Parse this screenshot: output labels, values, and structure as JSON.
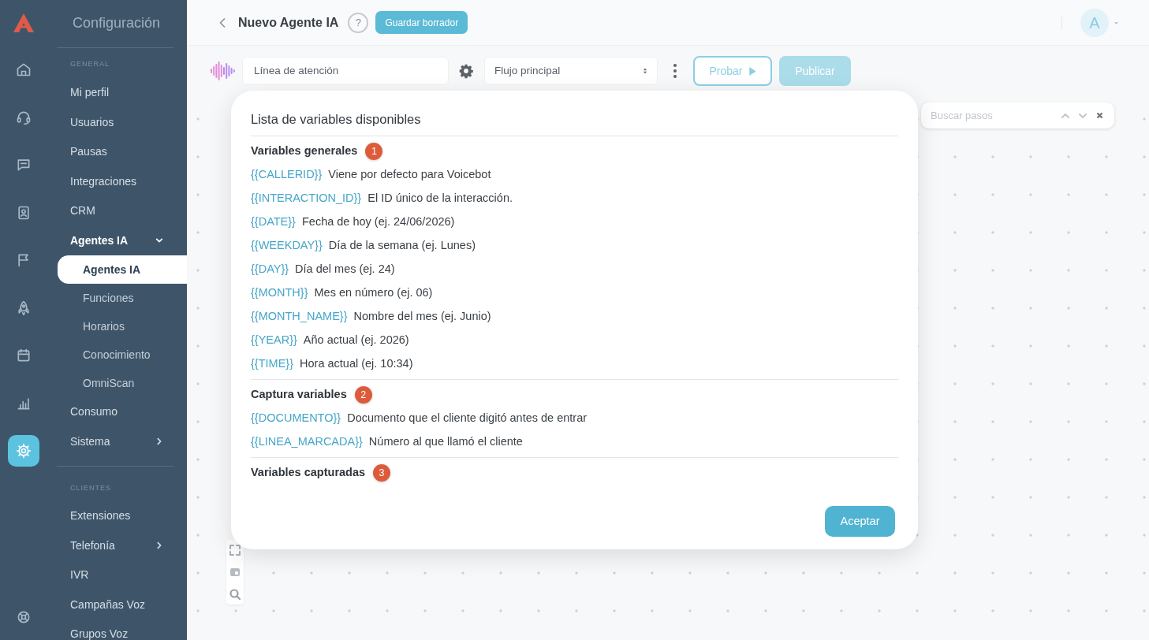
{
  "sidebar": {
    "rail": [
      {
        "kind": "home",
        "selected": false
      },
      {
        "kind": "headset",
        "selected": false
      },
      {
        "kind": "chat",
        "selected": false
      },
      {
        "kind": "contacts",
        "selected": false
      },
      {
        "kind": "flag",
        "selected": false
      },
      {
        "kind": "rocket",
        "selected": false
      },
      {
        "kind": "calendar",
        "selected": false
      },
      {
        "kind": "chart",
        "selected": false
      },
      {
        "kind": "settings",
        "selected": true
      }
    ],
    "rail_bottom": [
      {
        "kind": "support",
        "selected": false
      }
    ],
    "panel": {
      "title": "Configuración",
      "sections": [
        {
          "label": "GENERAL",
          "items": [
            {
              "label": "Mi perfil",
              "selected": false
            },
            {
              "label": "Usuarios",
              "selected": false
            },
            {
              "label": "Pausas",
              "selected": false
            },
            {
              "label": "Integraciones",
              "selected": false
            },
            {
              "label": "CRM",
              "selected": false
            },
            {
              "label": "Agentes IA",
              "selected": false,
              "expanded": true,
              "children": [
                {
                  "label": "Agentes IA",
                  "selected": true
                },
                {
                  "label": "Funciones",
                  "selected": false
                },
                {
                  "label": "Horarios",
                  "selected": false
                },
                {
                  "label": "Conocimiento",
                  "selected": false
                },
                {
                  "label": "OmniScan",
                  "selected": false
                }
              ]
            },
            {
              "label": "Consumo",
              "selected": false
            },
            {
              "label": "Sistema",
              "selected": false,
              "expanded": false
            }
          ]
        },
        {
          "label": "CLIENTES",
          "items": [
            {
              "label": "Extensiones",
              "selected": false
            },
            {
              "label": "Telefonía",
              "selected": false,
              "expanded": false
            },
            {
              "label": "IVR",
              "selected": false
            },
            {
              "label": "Campañas Voz",
              "selected": false
            },
            {
              "label": "Grupos Voz",
              "selected": false
            }
          ]
        }
      ]
    }
  },
  "header": {
    "title": "Nuevo Agente IA",
    "help": "?",
    "save_button": "Guardar borrador",
    "avatar": "A"
  },
  "toolbar": {
    "name_field": {
      "value": "Línea de atención"
    },
    "flow_select": {
      "value": "Flujo principal"
    },
    "test_button": "Probar",
    "publish_button": {
      "label": "Publicar",
      "disabled": true
    }
  },
  "canvas": {
    "search": {
      "placeholder": "Buscar pasos"
    }
  },
  "modal": {
    "title": "Lista de variables disponibles",
    "sections": [
      {
        "title": "Variables generales",
        "badge": "1",
        "variables": [
          {
            "name": "{{CALLERID}}",
            "description": "Viene por defecto para Voicebot"
          },
          {
            "name": "{{INTERACTION_ID}}",
            "description": "El ID único de la interacción."
          },
          {
            "name": "{{DATE}}",
            "description": "Fecha de hoy (ej. 24/06/2026)"
          },
          {
            "name": "{{WEEKDAY}}",
            "description": "Día de la semana (ej. Lunes)"
          },
          {
            "name": "{{DAY}}",
            "description": "Día del mes (ej. 24)"
          },
          {
            "name": "{{MONTH}}",
            "description": "Mes en número (ej. 06)"
          },
          {
            "name": "{{MONTH_NAME}}",
            "description": "Nombre del mes (ej. Junio)"
          },
          {
            "name": "{{YEAR}}",
            "description": "Año actual (ej. 2026)"
          },
          {
            "name": "{{TIME}}",
            "description": "Hora actual (ej. 10:34)"
          }
        ]
      },
      {
        "title": "Captura variables",
        "badge": "2",
        "variables": [
          {
            "name": "{{DOCUMENTO}}",
            "description": "Documento que el cliente digitó antes de entrar"
          },
          {
            "name": "{{LINEA_MARCADA}}",
            "description": "Número al que llamó el cliente"
          }
        ]
      },
      {
        "title": "Variables capturadas",
        "badge": "3"
      }
    ],
    "button": "Aceptar"
  }
}
